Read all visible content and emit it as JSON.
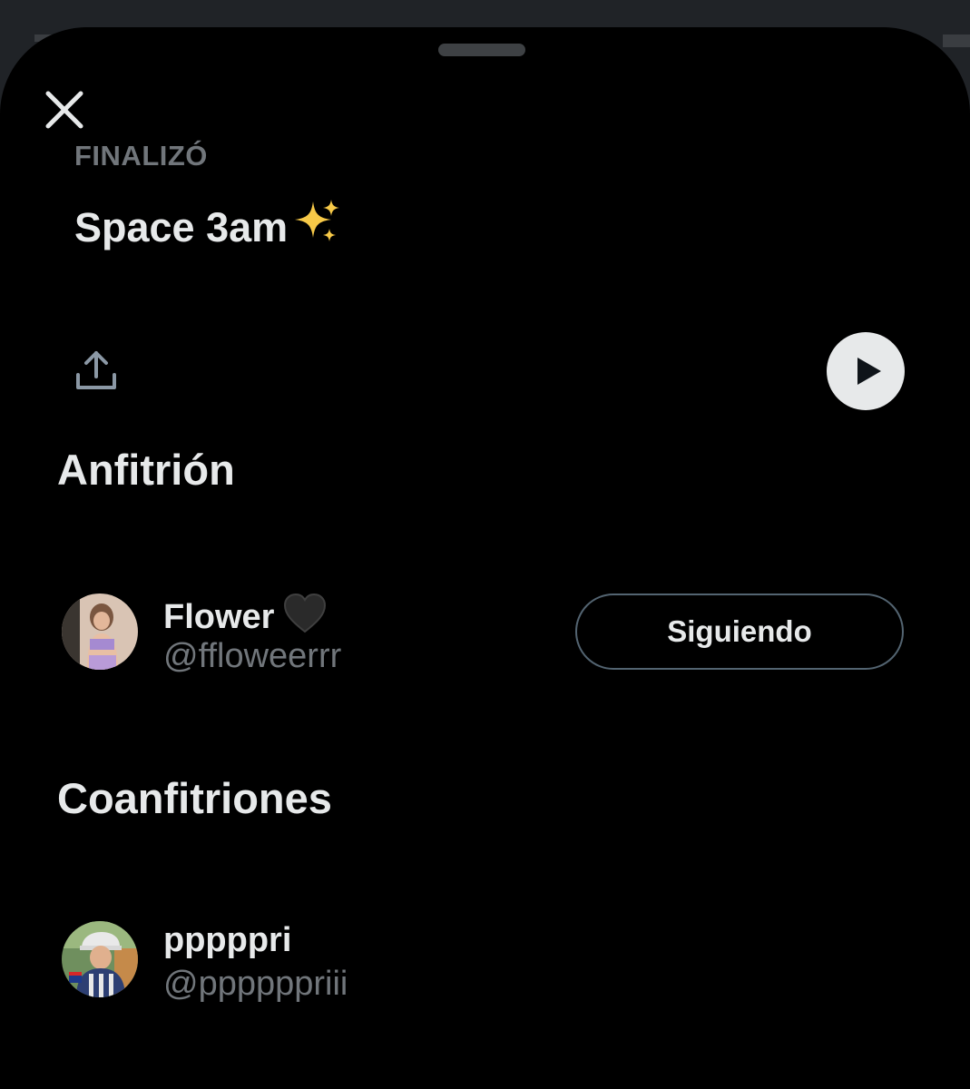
{
  "sheet": {
    "status_label": "FINALIZÓ",
    "title": "Space 3am",
    "title_icon": "sparkles-icon"
  },
  "actions": {
    "share_icon": "share-icon",
    "play_icon": "play-icon"
  },
  "host_section": {
    "heading": "Anfitrión",
    "user": {
      "name": "Flower",
      "name_icon": "black-heart-icon",
      "handle": "@ffloweerrr",
      "follow_label": "Siguiendo"
    }
  },
  "cohost_section": {
    "heading": "Coanfitriones",
    "user": {
      "name": "pppppri",
      "handle": "@ppppppriii"
    }
  },
  "colors": {
    "background": "#000000",
    "text_primary": "#e7e9ea",
    "text_secondary": "#71767b",
    "button_border": "#536471"
  }
}
